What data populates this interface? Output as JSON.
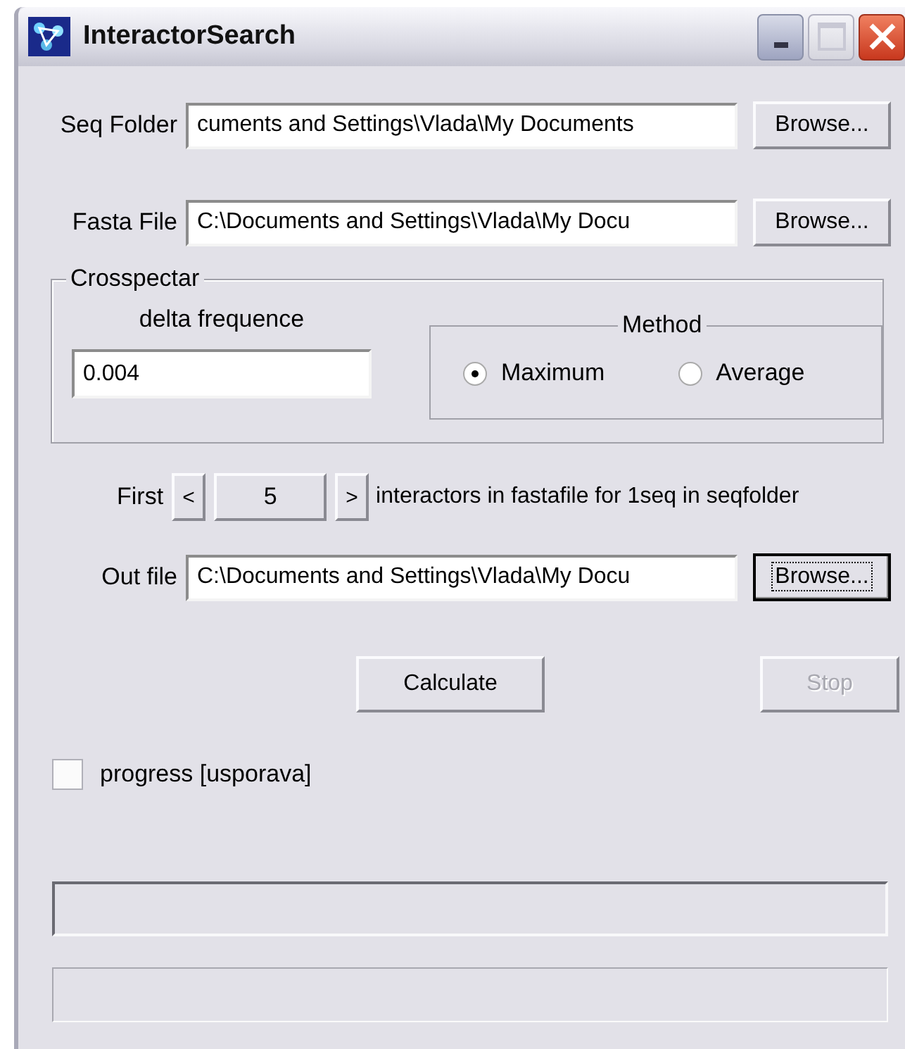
{
  "window": {
    "title": "InteractorSearch"
  },
  "path_rows": [
    {
      "label": "Seq Folder",
      "value": "cuments and Settings\\Vlada\\My Documents",
      "button": {
        "label": "Browse...",
        "focused": false
      }
    },
    {
      "label": "Fasta File",
      "value": "C:\\Documents and Settings\\Vlada\\My Docu",
      "button": {
        "label": "Browse...",
        "focused": false
      }
    }
  ],
  "crosspectar": {
    "title": "Crosspectar",
    "delta_label": "delta frequence",
    "delta_value": "0.004",
    "method": {
      "title": "Method",
      "options": [
        {
          "label": "Maximum",
          "selected": true
        },
        {
          "label": "Average",
          "selected": false
        }
      ]
    }
  },
  "first_row": {
    "label": "First",
    "decrement": "<",
    "value": "5",
    "increment": ">",
    "suffix": "interactors in fastafile for 1seq in seqfolder"
  },
  "out_row": {
    "label": "Out file",
    "value": "C:\\Documents and Settings\\Vlada\\My Docu",
    "button": {
      "label": "Browse...",
      "focused": true
    }
  },
  "actions": [
    {
      "label": "Calculate",
      "disabled": false
    },
    {
      "label": "Stop",
      "disabled": true
    }
  ],
  "checkbox": {
    "label": "progress [usporava]",
    "checked": false
  },
  "progress_bars": [
    {
      "kind": "sunken",
      "level": 0
    },
    {
      "kind": "flat",
      "level": 0
    }
  ]
}
